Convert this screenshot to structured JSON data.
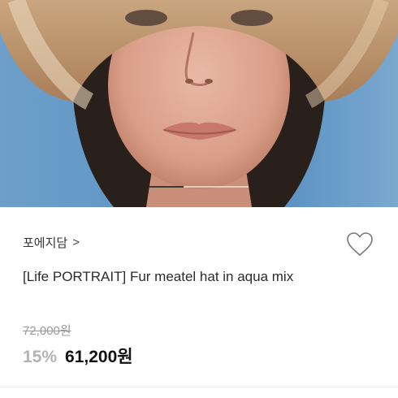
{
  "product": {
    "brand": "포에지담",
    "brand_chevron": ">",
    "title": "[Life PORTRAIT] Fur meatel hat in aqua mix",
    "original_price": "72,000원",
    "discount": "15%",
    "price": "61,200원"
  },
  "icons": {
    "wishlist": "heart-outline-icon",
    "brand_link": "chevron-right-icon"
  },
  "colors": {
    "hero_background": "#5f95c4",
    "discount": "#b3b3b3",
    "price": "#111111"
  }
}
